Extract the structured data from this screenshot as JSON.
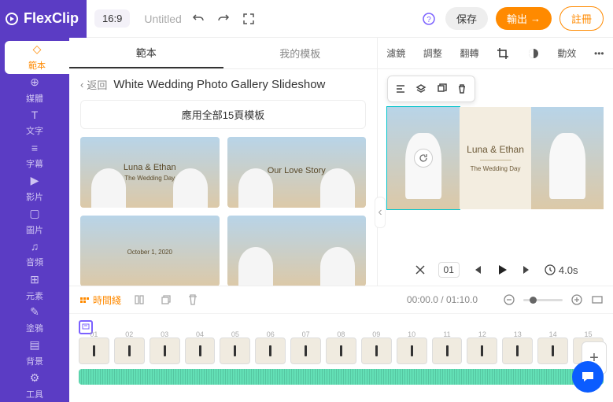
{
  "top": {
    "logo": "FlexClip",
    "ratio": "16:9",
    "untitled": "Untitled",
    "save": "保存",
    "export": "輸出",
    "signup": "註冊"
  },
  "side": [
    {
      "label": "範本",
      "active": true
    },
    {
      "label": "媒體"
    },
    {
      "label": "文字"
    },
    {
      "label": "字幕"
    },
    {
      "label": "影片"
    },
    {
      "label": "圖片"
    },
    {
      "label": "音頻"
    },
    {
      "label": "元素"
    },
    {
      "label": "塗鴉"
    },
    {
      "label": "背景"
    },
    {
      "label": "工具"
    }
  ],
  "tabs": {
    "template": "範本",
    "mine": "我的模板"
  },
  "template": {
    "back": "返回",
    "title": "White Wedding Photo Gallery Slideshow",
    "apply": "應用全部15頁模板",
    "thumbs": [
      {
        "caption": "Luna & Ethan",
        "sub": "The Wedding Day"
      },
      {
        "caption": "Our Love Story",
        "sub": ""
      },
      {
        "caption": "",
        "sub": "October 1, 2020"
      },
      {
        "caption": "",
        "sub": ""
      }
    ]
  },
  "previewTabs": [
    "濾鏡",
    "調整",
    "翻轉"
  ],
  "preview": {
    "title": "Luna & Ethan",
    "sub": "The Wedding Day"
  },
  "controls": {
    "scene": "01",
    "duration": "4.0s"
  },
  "tl": {
    "mode": "時間綫",
    "time": "00:00.0 / 01:10.0",
    "clips": [
      "01",
      "02",
      "03",
      "04",
      "05",
      "06",
      "07",
      "08",
      "09",
      "10",
      "11",
      "12",
      "13",
      "14",
      "15"
    ]
  }
}
